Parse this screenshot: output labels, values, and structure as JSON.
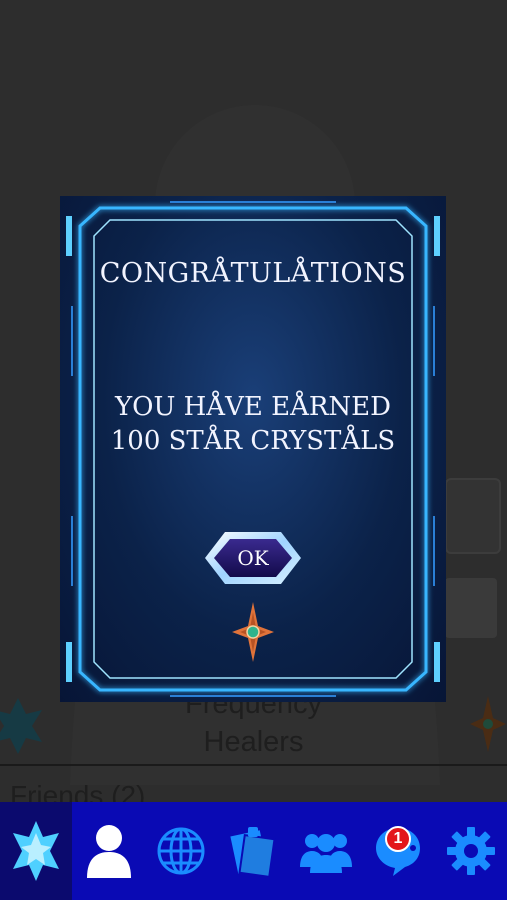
{
  "background": {
    "group_name_line1": "Frequency",
    "group_name_line2": "Healers",
    "friends_label": "Friends (2)"
  },
  "modal": {
    "title": "CONGRÅTULÅTIONS",
    "message_line1": "YOU HÅVE EÅRNED",
    "message_line2": "100 STÅR CRYSTÅLS",
    "ok_label": "OK"
  },
  "bottom_nav": {
    "items": [
      {
        "icon": "crystal-icon",
        "active": true
      },
      {
        "icon": "profile-icon"
      },
      {
        "icon": "globe-icon"
      },
      {
        "icon": "notes-icon"
      },
      {
        "icon": "group-icon"
      },
      {
        "icon": "chat-icon"
      },
      {
        "icon": "settings-icon"
      }
    ],
    "chat_badge_count": "1"
  },
  "colors": {
    "nav_background": "#0a0ab4",
    "nav_active": "#0b0a6e",
    "nav_icon_blue": "#1a8cff",
    "frame_glow": "#37b6ff",
    "badge_red": "#e3161b"
  }
}
